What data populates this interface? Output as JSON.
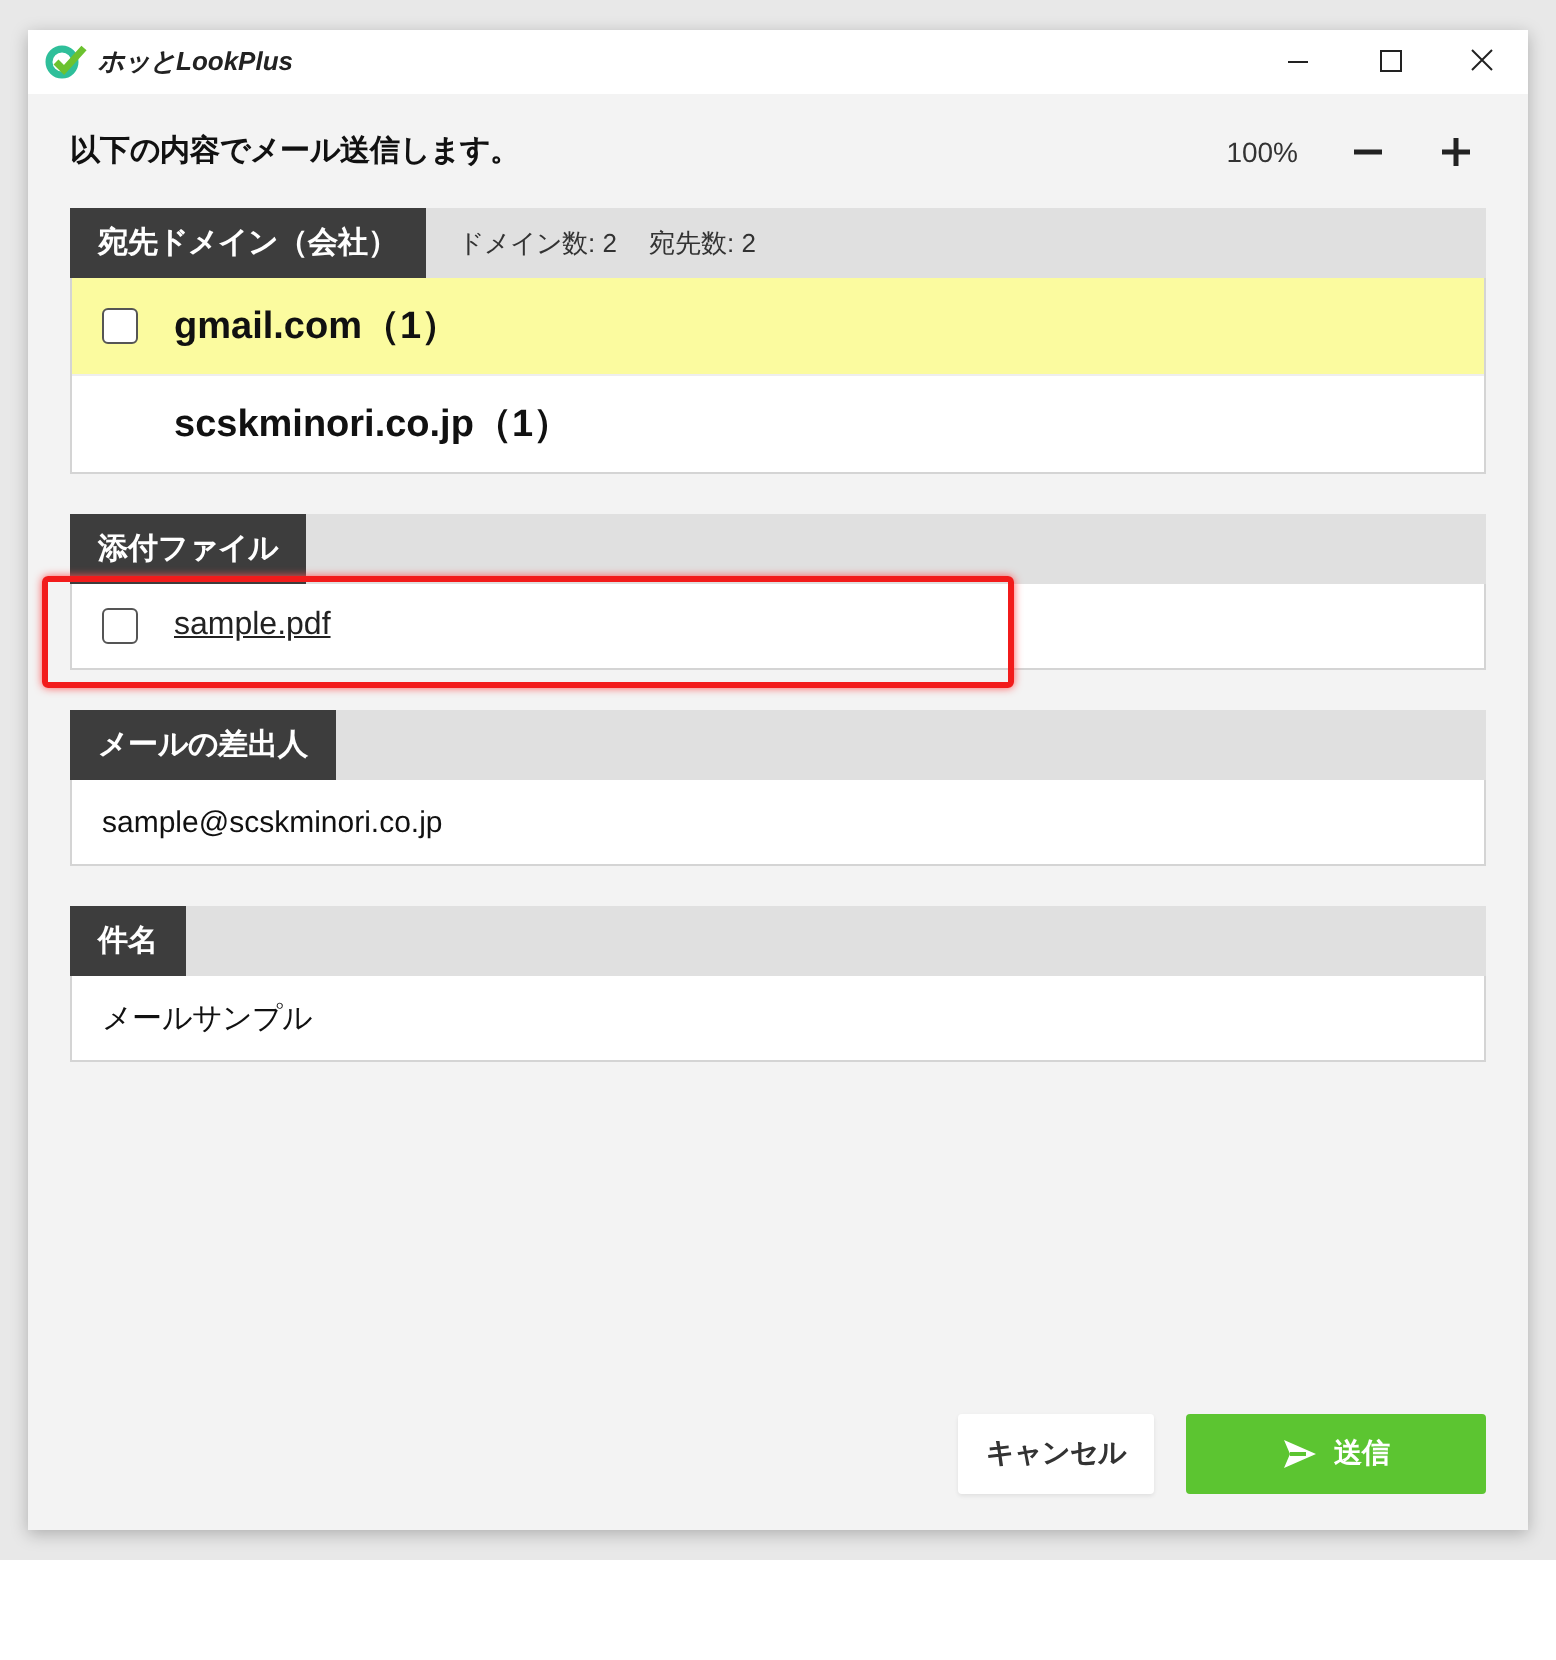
{
  "window": {
    "title": "ホッとLookPlus"
  },
  "heading": "以下の内容でメール送信します。",
  "zoom": {
    "reading": "100%"
  },
  "sections": [
    {
      "title": "宛先ドメイン（会社）",
      "counts": [
        "ドメイン数: 2",
        "宛先数: 2"
      ],
      "annotated": false,
      "items": [
        {
          "kind": "domain",
          "label": "gmail.com（1）",
          "checked": false,
          "highlighted": true
        },
        {
          "kind": "domain",
          "label": "scskminori.co.jp（1）",
          "highlighted": false
        }
      ]
    },
    {
      "title": "添付ファイル",
      "annotated": true,
      "items": [
        {
          "kind": "file",
          "label": "sample.pdf",
          "checked": false
        }
      ]
    },
    {
      "title": "メールの差出人",
      "annotated": false,
      "items": [
        {
          "kind": "text",
          "label": "sample@scskminori.co.jp"
        }
      ]
    },
    {
      "title": "件名",
      "annotated": false,
      "items": [
        {
          "kind": "text",
          "label": "メールサンプル"
        }
      ]
    }
  ],
  "buttons": [
    {
      "kind": "secondary",
      "label": "キャンセル"
    },
    {
      "kind": "primary",
      "label": "送信"
    }
  ]
}
